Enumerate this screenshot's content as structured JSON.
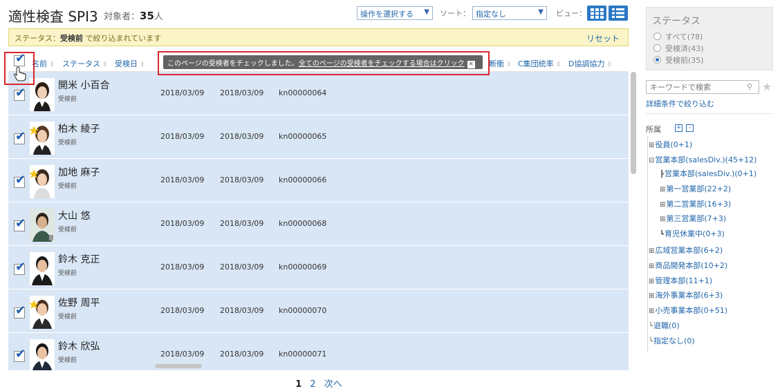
{
  "header": {
    "title": "適性検査 SPI3",
    "target_label": "対象者：",
    "target_count": "35",
    "target_unit": "人",
    "operation_select": "操作を選択する",
    "sort_label": "ソート：",
    "sort_select": "指定なし",
    "view_label": "ビュー："
  },
  "filter": {
    "prefix": "ステータス：",
    "value": "受検前",
    "suffix": " で絞り込まれています",
    "reset": "リセット"
  },
  "columns": {
    "name": "名前",
    "status": "ステータス",
    "exam_date": "受検日",
    "col_partial": "断衝",
    "c_col": "C集団統率",
    "d_col": "D協調協力"
  },
  "tooltip": {
    "text": "このページの受検者をチェックしました。",
    "link": "全てのページの受検者をチェックする場合はクリック",
    "close": "×"
  },
  "rows": [
    {
      "name": "開米 小百合",
      "status": "受検前",
      "date1": "2018/03/09",
      "date2": "2018/03/09",
      "code": "kn00000064"
    },
    {
      "name": "柏木 綾子",
      "status": "受検前",
      "date1": "2018/03/09",
      "date2": "2018/03/09",
      "code": "kn00000065"
    },
    {
      "name": "加地 麻子",
      "status": "受検前",
      "date1": "2018/03/09",
      "date2": "2018/03/09",
      "code": "kn00000066"
    },
    {
      "name": "大山 悠",
      "status": "受検前",
      "date1": "2018/03/09",
      "date2": "2018/03/09",
      "code": "kn00000068"
    },
    {
      "name": "鈴木 克正",
      "status": "受検前",
      "date1": "2018/03/09",
      "date2": "2018/03/09",
      "code": "kn00000069"
    },
    {
      "name": "佐野 周平",
      "status": "受検前",
      "date1": "2018/03/09",
      "date2": "2018/03/09",
      "code": "kn00000070"
    },
    {
      "name": "鈴木 欣弘",
      "status": "受検前",
      "date1": "2018/03/09",
      "date2": "2018/03/09",
      "code": "kn00000071"
    }
  ],
  "pager": {
    "current": "1",
    "page2": "2",
    "next": "次へ"
  },
  "sidebar": {
    "status_title": "ステータス",
    "status_options": [
      "すべて(78)",
      "受検済(43)",
      "受検前(35)"
    ],
    "keyword_placeholder": "キーワードで検索",
    "advanced_link": "詳細条件で絞り込む",
    "tree_title": "所属",
    "tree": [
      "役員(0+1)",
      "営業本部(salesDiv.)(45+12)",
      "営業本部(salesDiv.)(0+1)",
      "第一営業部(22+2)",
      "第二営業部(16+3)",
      "第三営業部(7+3)",
      "育児休業中(0+3)",
      "広域営業本部(6+2)",
      "商品開発本部(10+2)",
      "管理本部(11+1)",
      "海外事業本部(6+3)",
      "小売事業本部(0+51)",
      "退職(0)",
      "指定なし(0)"
    ]
  },
  "colors": {
    "accent": "#2b78c5",
    "row_bg": "#d9e6f5",
    "highlight_border": "#d9262c",
    "filter_bg": "#fbf4c8"
  },
  "icons": [
    "checkbox-checked-icon",
    "hand-cursor-icon",
    "tile-view-icon",
    "list-view-icon",
    "search-icon",
    "star-icon",
    "sort-arrows-icon",
    "close-icon",
    "tree-expand-icon",
    "tree-collapse-icon"
  ]
}
